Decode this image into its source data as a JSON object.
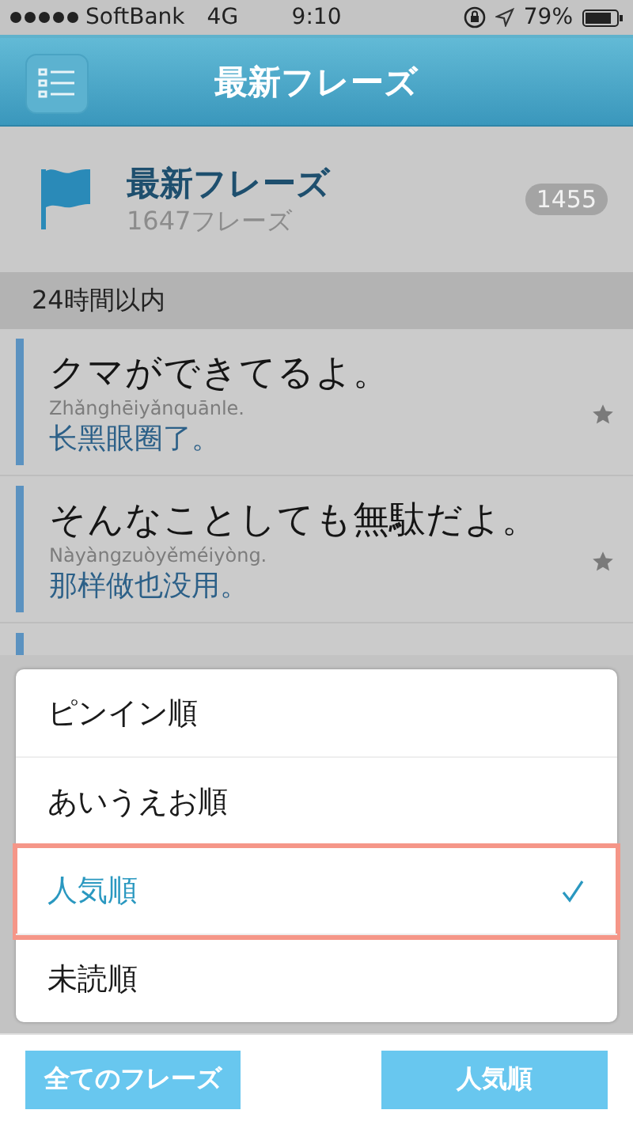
{
  "status_bar": {
    "carrier": "SoftBank",
    "network": "4G",
    "time": "9:10",
    "battery": "79%"
  },
  "header": {
    "title": "最新フレーズ"
  },
  "folder": {
    "title": "最新フレーズ",
    "subtitle": "1647フレーズ",
    "badge": "1455"
  },
  "section": {
    "title": "24時間以内"
  },
  "phrases": [
    {
      "japanese": "クマができてるよ。",
      "pinyin": "Zhǎnghēiyǎnquānle.",
      "chinese": "长黑眼圈了。"
    },
    {
      "japanese": "そんなことしても無駄だよ。",
      "pinyin": "Nàyàngzuòyěméiyòng.",
      "chinese": "那样做也没用。"
    }
  ],
  "sort_menu": {
    "options": [
      {
        "label": "ピンイン順",
        "selected": false,
        "highlighted": false
      },
      {
        "label": "あいうえお順",
        "selected": false,
        "highlighted": false
      },
      {
        "label": "人気順",
        "selected": true,
        "highlighted": true
      },
      {
        "label": "未読順",
        "selected": false,
        "highlighted": false
      }
    ]
  },
  "bottom_bar": {
    "buttons": [
      "全てのフレーズ",
      "人気順"
    ]
  }
}
